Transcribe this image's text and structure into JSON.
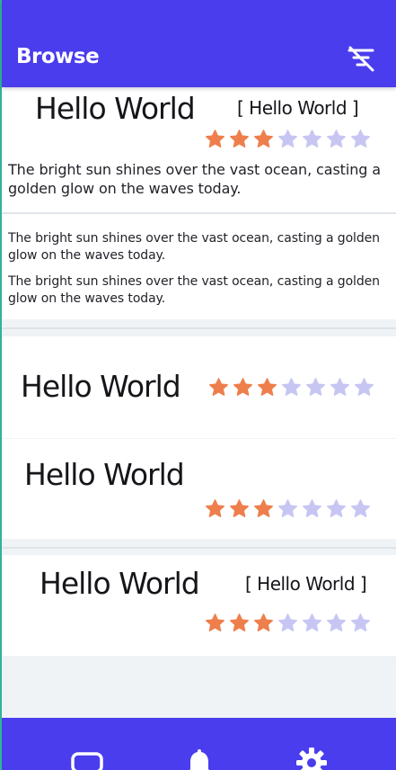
{
  "header": {
    "title": "Browse",
    "filter_icon": "filter-clear-icon"
  },
  "colors": {
    "primary": "#4a3ded",
    "star_filled": "#ee7f4d",
    "star_empty": "#c7c6f3"
  },
  "cards": [
    {
      "title": "Hello World",
      "tag": "[ Hello World ]",
      "rating": 3,
      "max_rating": 7,
      "text": "The bright sun shines over the vast ocean, casting a golden glow on the waves today."
    },
    {
      "paragraphs": [
        "The bright sun shines over the vast ocean, casting a golden glow on the waves today.",
        "The bright sun shines over the vast ocean, casting a golden glow on the waves today."
      ]
    },
    {
      "title": "Hello World",
      "rating": 3,
      "max_rating": 7
    },
    {
      "title": "Hello World",
      "rating": 3,
      "max_rating": 7
    },
    {
      "title": "Hello World",
      "tag": "[ Hello World ]",
      "rating": 3,
      "max_rating": 7
    }
  ],
  "bottom_nav": [
    {
      "icon": "tablet-icon"
    },
    {
      "icon": "bell-icon"
    },
    {
      "icon": "gear-icon"
    }
  ]
}
